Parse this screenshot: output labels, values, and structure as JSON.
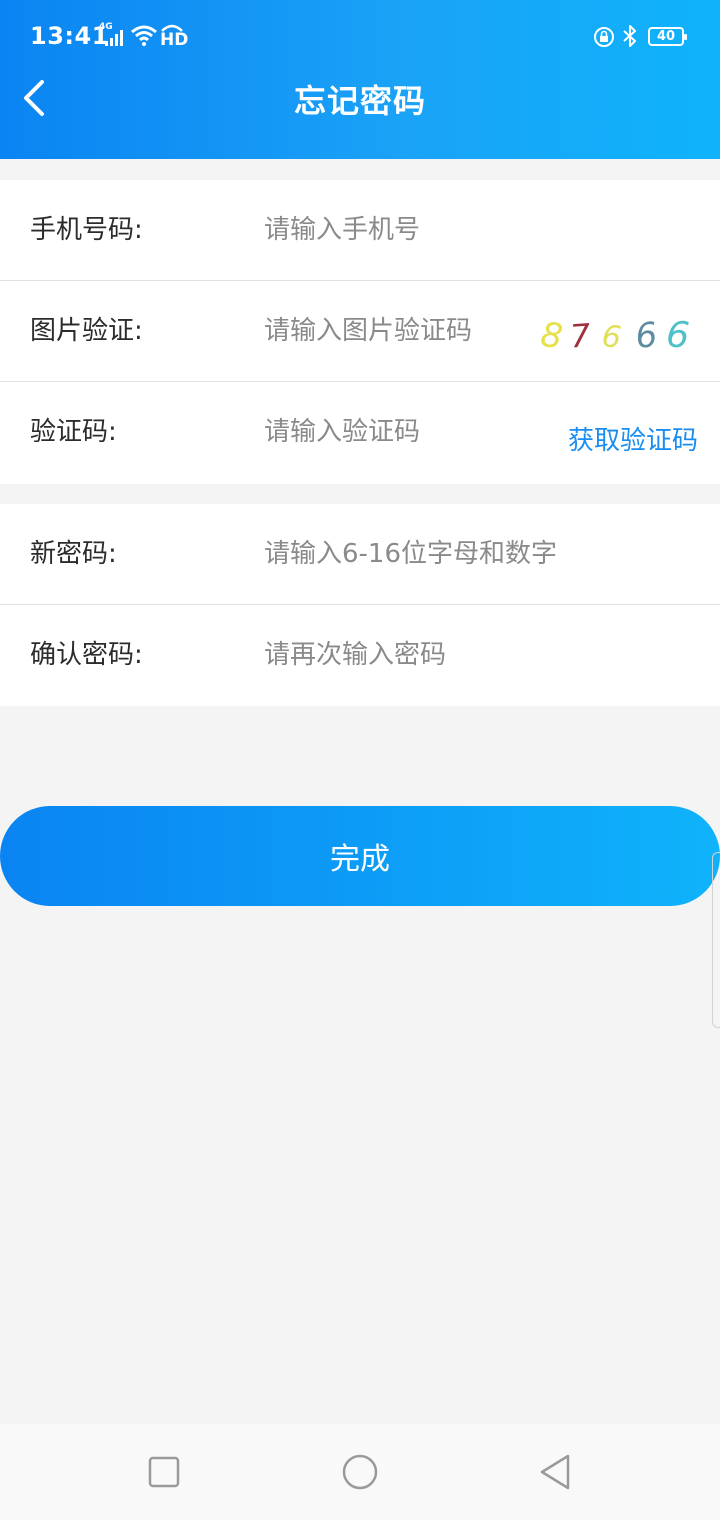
{
  "status_bar": {
    "time": "13:41",
    "network": "4G",
    "hd": "HD",
    "battery": "40"
  },
  "header": {
    "title": "忘记密码"
  },
  "form": {
    "phone": {
      "label": "手机号码:",
      "placeholder": "请输入手机号"
    },
    "image_code": {
      "label": "图片验证:",
      "placeholder": "请输入图片验证码",
      "captcha_digits": [
        "8",
        "7",
        "6",
        "6",
        "6"
      ],
      "captcha_colors": [
        "#e6e04a",
        "#a0303d",
        "#dfe05a",
        "#5d8ca0",
        "#4dc1c8"
      ]
    },
    "sms_code": {
      "label": "验证码:",
      "placeholder": "请输入验证码",
      "get_code_label": "获取验证码"
    },
    "new_password": {
      "label": "新密码:",
      "placeholder": "请输入6-16位字母和数字"
    },
    "confirm_password": {
      "label": "确认密码:",
      "placeholder": "请再次输入密码"
    }
  },
  "submit_label": "完成",
  "colors": {
    "accent": "#1a8df2",
    "header_start": "#0a84f2",
    "header_end": "#0fb3fb"
  }
}
